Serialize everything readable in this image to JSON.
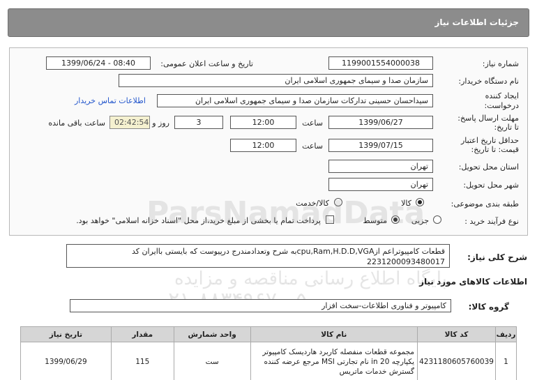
{
  "page_title": "جزئیات اطلاعات نیاز",
  "fields": {
    "need_number_label": "شماره نیاز:",
    "need_number": "1199001554000038",
    "announce_label": "تاریخ و ساعت اعلان عمومی:",
    "announce_value": "1399/06/24 - 08:40",
    "buyer_org_label": "نام دستگاه خریدار:",
    "buyer_org": "سازمان صدا و سیمای جمهوری اسلامی ایران",
    "creator_label_1": "ایجاد کننده",
    "creator_label_2": "درخواست:",
    "creator": "سیداحسان حسینی تدارکات سازمان صدا و سیمای جمهوری اسلامی ایران",
    "contact_link": "اطلاعات تماس خریدار",
    "reply_deadline_label_1": "مهلت ارسال پاسخ:",
    "reply_deadline_label_2": "تا تاریخ:",
    "reply_date": "1399/06/27",
    "time_label": "ساعت",
    "reply_time": "12:00",
    "days_value": "3",
    "days_label": "روز و",
    "remaining_time": "02:42:54",
    "remaining_label": "ساعت باقی مانده",
    "validity_label_1": "حداقل تاریخ اعتبار",
    "validity_label_2": "قیمت: تا تاریخ:",
    "validity_date": "1399/07/15",
    "validity_time": "12:00",
    "province_label": "استان محل تحویل:",
    "province": "تهران",
    "city_label": "شهر محل تحویل:",
    "city": "تهران",
    "category_label": "طبقه بندی موضوعی:",
    "category_goods": "کالا",
    "category_goods_service": "کالا/خدمت",
    "process_label": "نوع فرآیند خرید :",
    "process_partial": "جزیی",
    "process_medium": "متوسط",
    "payment_note": "پرداخت تمام یا بخشی از مبلغ خرید،از محل \"اسناد خزانه اسلامی\" خواهد بود."
  },
  "description": {
    "label": "شرح کلی نیاز:",
    "text": "قطعات کامپیوتراعم ازcpu,Ram,H.D.D,VGAبه شرح وتعدادمندرج درپیوست که بایستی باایران کد 2231200093480017"
  },
  "goods_section_title": "اطلاعات کالاهای مورد نیاز",
  "goods_group_label": "گروه کالا:",
  "goods_group": "کامپیوتر و فناوری اطلاعات-سخت افزار",
  "table": {
    "headers": [
      "ردیف",
      "کد کالا",
      "نام کالا",
      "واحد شمارش",
      "مقدار",
      "تاریخ نیاز"
    ],
    "rows": [
      {
        "row": "1",
        "code": "4231180605760039",
        "name": "مجموعه قطعات منفصله کاربرد هاردیسک کامپیوتر یکپارچه in 20 نام تجارتی MSI مرجع عرضه کننده گسترش خدمات ماتریس",
        "unit": "ست",
        "qty": "115",
        "date": "1399/06/29"
      }
    ]
  },
  "watermark": {
    "brand": "ParsNamadData",
    "line": "پایگاه اطلاع رسانی مناقصه و مزایده",
    "phone": "۰۲۱-۸۸۳۴۹۶۷۰-۵"
  }
}
